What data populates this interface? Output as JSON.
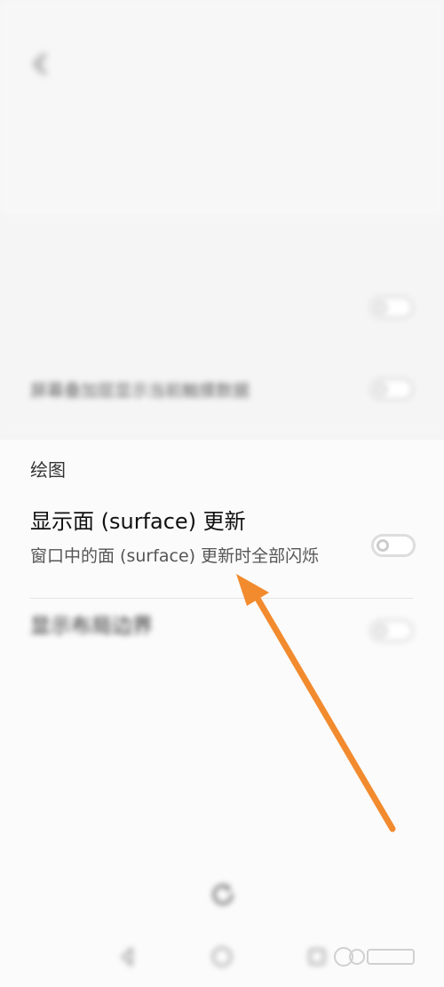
{
  "status_bar": {
    "left_text": "",
    "right_text": ""
  },
  "top": {
    "title": "",
    "section_title": "",
    "avrcp_title": "",
    "avrcp_sub": ""
  },
  "input_section": {
    "title": "",
    "row_a_title": "",
    "row_a_sub": "",
    "row_b_title": "",
    "row_b_sub": "屏幕叠加层显示当前触摸数据"
  },
  "drawing_section": {
    "title": "绘图",
    "surface_title": "显示面 (surface) 更新",
    "surface_sub": "窗口中的面 (surface) 更新时全部闪烁",
    "layout_title": "显示布局边界",
    "layout_sub": "",
    "window_scale": "",
    "window_value": "",
    "transition_scale": "",
    "transition_value": "",
    "animator_scale": "",
    "animator_value": ""
  },
  "bottom": {
    "refresh_label": ""
  },
  "colors": {
    "arrow": "#f28a2e",
    "switch_off": "#cfcfcf"
  },
  "icons": {
    "back": "back-arrow-icon",
    "refresh": "refresh-icon",
    "nav_back": "triangle-back-icon",
    "nav_home": "circle-home-icon",
    "nav_recent": "square-recent-icon"
  }
}
